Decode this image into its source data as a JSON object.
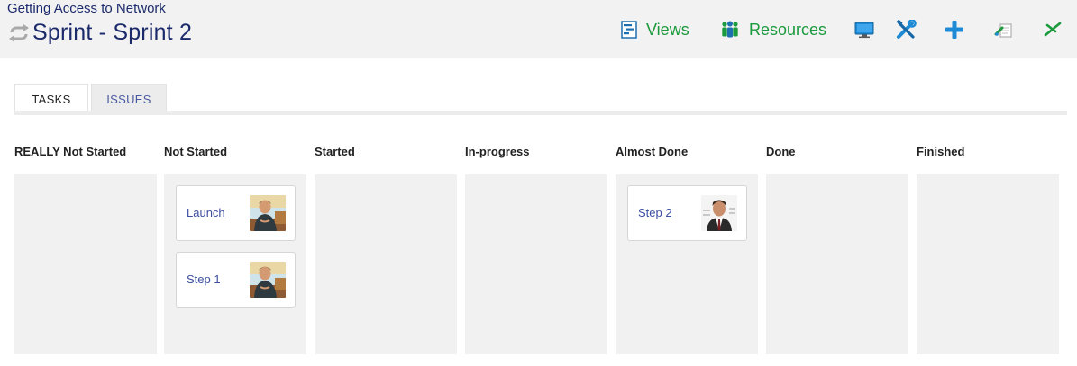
{
  "header": {
    "breadcrumb": "Getting Access to Network",
    "title": "Sprint - Sprint 2",
    "sprint_icon": "sprint-cycle-icon"
  },
  "toolbar": {
    "views_label": "Views",
    "views_icon": "gantt-views-icon",
    "resources_label": "Resources",
    "resources_icon": "people-icon",
    "monitor_icon": "monitor-icon",
    "tools_icon": "tools-icon",
    "add_icon": "plus-icon",
    "edit_icon": "edit-document-icon",
    "close_icon": "close-icon",
    "accent_color": "#1a9a3c",
    "blue_color": "#1e8ad6"
  },
  "tabs": [
    {
      "label": "TASKS",
      "active": true
    },
    {
      "label": "ISSUES",
      "active": false
    }
  ],
  "columns": [
    {
      "title": "REALLY Not Started",
      "cards": []
    },
    {
      "title": "Not Started",
      "cards": [
        {
          "label": "Launch",
          "avatar": "user-avatar-outdoor"
        },
        {
          "label": "Step 1",
          "avatar": "user-avatar-outdoor"
        }
      ]
    },
    {
      "title": "Started",
      "cards": []
    },
    {
      "title": "In-progress",
      "cards": []
    },
    {
      "title": "Almost Done",
      "cards": [
        {
          "label": "Step 2",
          "avatar": "user-avatar-office"
        }
      ]
    },
    {
      "title": "Done",
      "cards": []
    },
    {
      "title": "Finished",
      "cards": []
    }
  ]
}
